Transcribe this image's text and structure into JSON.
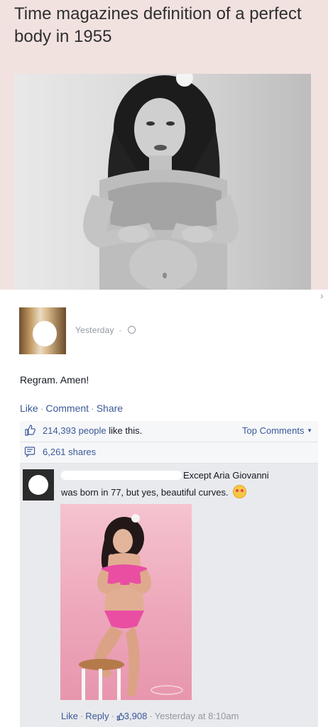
{
  "meme": {
    "title": "Time magazines definition of a perfect body in 1955"
  },
  "post": {
    "timestamp": "Yesterday",
    "text": "Regram. Amen!",
    "actions": {
      "like": "Like",
      "comment": "Comment",
      "share": "Share"
    }
  },
  "ufi": {
    "likes_count": "214,393 people",
    "likes_suffix": " like this.",
    "top_comments": "Top Comments",
    "shares": "6,261 shares"
  },
  "comment": {
    "text_line1": "Except Aria Giovanni",
    "text_line2": "was born in 77, but yes, beautiful curves.",
    "actions": {
      "like": "Like",
      "reply": "Reply",
      "like_count": "3,908",
      "timestamp": "Yesterday at 8:10am"
    }
  },
  "colors": {
    "link": "#3b5998",
    "meta": "#9197a3",
    "meme_bg": "#f1e2e0",
    "ufi_bg": "#e9eaed"
  },
  "icons": [
    "globe-icon",
    "thumbs-up-icon",
    "share-icon",
    "heart-eyes-emoji-icon",
    "chevron-right-icon",
    "caret-down-icon"
  ]
}
